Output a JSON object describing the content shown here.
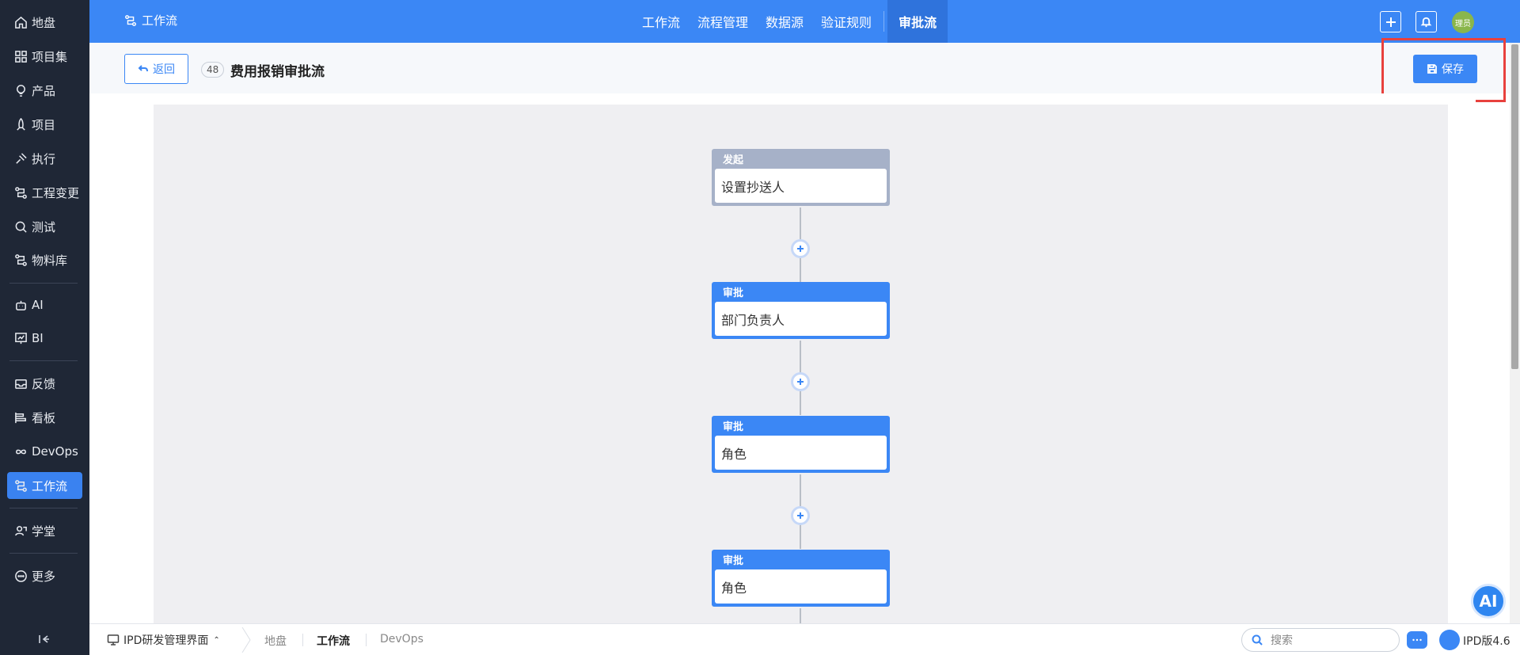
{
  "sidebar": {
    "items": [
      {
        "label": "地盘",
        "icon": "home-icon"
      },
      {
        "label": "项目集",
        "icon": "grid-icon"
      },
      {
        "label": "产品",
        "icon": "bulb-icon"
      },
      {
        "label": "项目",
        "icon": "rocket-icon"
      },
      {
        "label": "执行",
        "icon": "pin-icon"
      },
      {
        "label": "工程变更",
        "icon": "flow-icon"
      },
      {
        "label": "测试",
        "icon": "search-icon"
      },
      {
        "label": "物料库",
        "icon": "flow-icon"
      },
      {
        "label": "AI",
        "icon": "robot-icon"
      },
      {
        "label": "BI",
        "icon": "chart-icon"
      },
      {
        "label": "反馈",
        "icon": "inbox-icon"
      },
      {
        "label": "看板",
        "icon": "board-icon"
      },
      {
        "label": "DevOps",
        "icon": "infinity-icon"
      },
      {
        "label": "工作流",
        "icon": "flow-icon",
        "active": true
      },
      {
        "label": "学堂",
        "icon": "school-icon"
      },
      {
        "label": "更多",
        "icon": "more-icon"
      }
    ]
  },
  "topbar": {
    "title": "工作流",
    "nav": [
      "工作流",
      "流程管理",
      "数据源",
      "验证规则"
    ],
    "active_nav": "审批流",
    "avatar": "理员"
  },
  "page": {
    "back_label": "返回",
    "id_badge": "48",
    "title": "费用报销审批流",
    "save_label": "保存"
  },
  "flow": {
    "nodes": [
      {
        "type": "start",
        "header": "发起",
        "body": "设置抄送人"
      },
      {
        "type": "approve",
        "header": "审批",
        "body": "部门负责人"
      },
      {
        "type": "approve",
        "header": "审批",
        "body": "角色"
      },
      {
        "type": "approve",
        "header": "审批",
        "body": "角色"
      }
    ]
  },
  "ai_fab": "AI",
  "bottombar": {
    "app": "IPD研发管理界面",
    "tabs": [
      "地盘",
      "工作流",
      "DevOps"
    ],
    "active_tab": "工作流",
    "search_placeholder": "搜索",
    "version": "IPD版4.6"
  },
  "colors": {
    "primary": "#3b87f5",
    "sidebar_bg": "#1f2736",
    "highlight": "#e8413d",
    "start_node": "#a6b1c8"
  }
}
